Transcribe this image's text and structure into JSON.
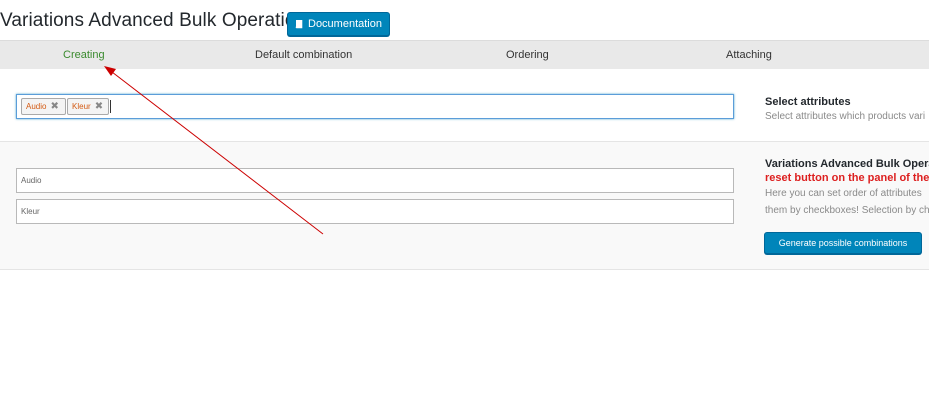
{
  "header": {
    "title": "Variations Advanced Bulk Operations -",
    "doc_button": "Documentation"
  },
  "tabs": [
    {
      "label": "Creating",
      "active": true
    },
    {
      "label": "Default combination",
      "active": false
    },
    {
      "label": "Ordering",
      "active": false
    },
    {
      "label": "Attaching",
      "active": false
    }
  ],
  "attributes": {
    "selected": [
      "Audio",
      "Kleur"
    ],
    "heading": "Select attributes",
    "description": "Select attributes which products vari"
  },
  "ordering": {
    "fields": [
      "Audio",
      "Kleur"
    ],
    "heading": "Variations Advanced Bulk Opera",
    "warning": "reset button on the panel of the",
    "text_line1": "Here you can set order of attributes",
    "text_line2": "them by checkboxes! Selection by ch",
    "generate_button": "Generate possible combinations"
  },
  "colors": {
    "accent": "#0085ba",
    "active_tab": "#3a8a2e",
    "warning": "#dd1f1f",
    "chip_text": "#d35a13",
    "annotation_arrow": "#cc0000"
  },
  "icons": {
    "doc_button_icon": "book-icon",
    "chip_remove": "close-icon"
  }
}
